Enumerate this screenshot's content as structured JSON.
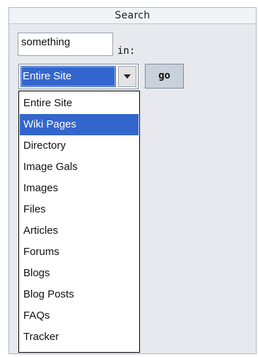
{
  "panel": {
    "title": "Search"
  },
  "search": {
    "query": "something",
    "in_label": "in:",
    "scope_selected": "Entire Site",
    "go_label": "go"
  },
  "dropdown": {
    "highlighted_index": 1,
    "options": [
      "Entire Site",
      "Wiki Pages",
      "Directory",
      "Image Gals",
      "Images",
      "Files",
      "Articles",
      "Forums",
      "Blogs",
      "Blog Posts",
      "FAQs",
      "Tracker"
    ]
  },
  "colors": {
    "highlight": "#3366cc",
    "panel_bg": "#e7e9ee",
    "panel_border": "#a8b8cf",
    "button_bg": "#c9d1db"
  },
  "icons": {
    "select_arrow": "chevron-down-icon"
  }
}
